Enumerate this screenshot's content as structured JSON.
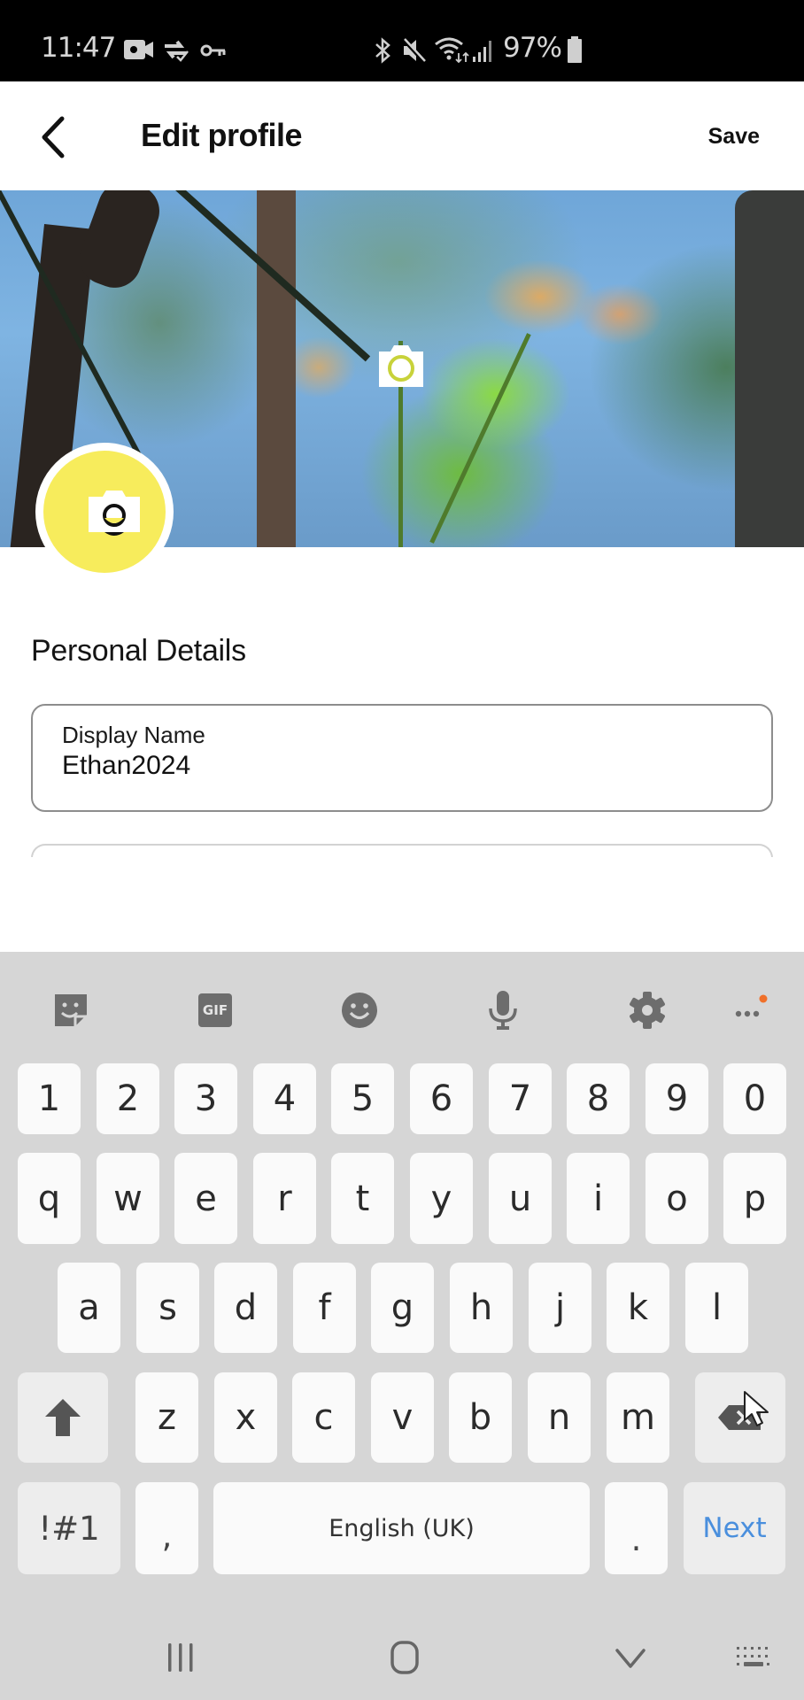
{
  "status_bar": {
    "time": "11:47",
    "left_icons": [
      "video-call-icon",
      "sync-check-icon",
      "vpn-key-icon"
    ],
    "right_icons": [
      "bluetooth-icon",
      "mute-icon",
      "wifi-icon",
      "signal-icon",
      "battery-icon"
    ],
    "battery": "97%"
  },
  "header": {
    "title": "Edit profile",
    "save_label": "Save",
    "back_icon": "chevron-left-icon"
  },
  "cover": {
    "icon": "camera-icon",
    "accent_color": "#f7ec5c"
  },
  "avatar": {
    "icon": "camera-icon",
    "color": "#f7ec5c"
  },
  "personal_details": {
    "section_title": "Personal Details",
    "fields": [
      {
        "label": "Display Name",
        "value": "Ethan2024"
      }
    ]
  },
  "keyboard": {
    "toolbar": [
      "sticker-icon",
      "gif-icon",
      "emoji-icon",
      "microphone-icon",
      "settings-icon",
      "more-icon"
    ],
    "gif_label": "GIF",
    "rows": [
      [
        "1",
        "2",
        "3",
        "4",
        "5",
        "6",
        "7",
        "8",
        "9",
        "0"
      ],
      [
        "q",
        "w",
        "e",
        "r",
        "t",
        "y",
        "u",
        "i",
        "o",
        "p"
      ],
      [
        "a",
        "s",
        "d",
        "f",
        "g",
        "h",
        "j",
        "k",
        "l"
      ],
      [
        "z",
        "x",
        "c",
        "v",
        "b",
        "n",
        "m"
      ]
    ],
    "symbols_label": "!#1",
    "comma_label": ",",
    "space_label": "English (UK)",
    "period_label": ".",
    "action_label": "Next",
    "action_color": "#4a8fdd",
    "notification_dot_color": "#f0702a"
  },
  "nav_bar": {
    "icons": [
      "recents-icon",
      "home-icon",
      "back-down-icon",
      "keyboard-switch-icon"
    ]
  }
}
